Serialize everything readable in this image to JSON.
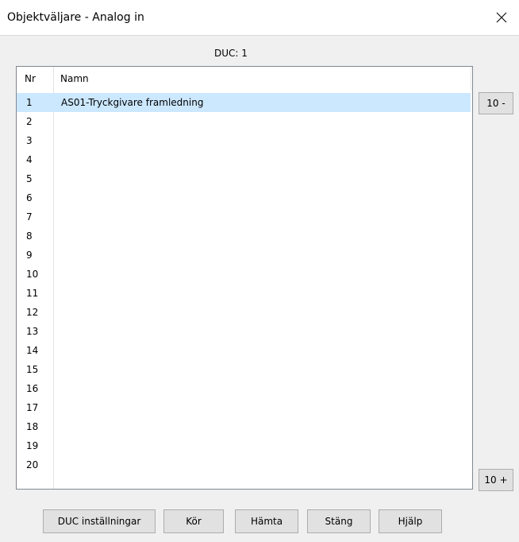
{
  "window": {
    "title": "Objektväljare - Analog in",
    "close_glyph": "✕"
  },
  "duc_label": "DUC:  1",
  "list": {
    "headers": {
      "nr": "Nr",
      "namn": "Namn"
    },
    "rows": [
      {
        "nr": "1",
        "namn": "AS01-Tryckgivare framledning"
      },
      {
        "nr": "2",
        "namn": ""
      },
      {
        "nr": "3",
        "namn": ""
      },
      {
        "nr": "4",
        "namn": ""
      },
      {
        "nr": "5",
        "namn": ""
      },
      {
        "nr": "6",
        "namn": ""
      },
      {
        "nr": "7",
        "namn": ""
      },
      {
        "nr": "8",
        "namn": ""
      },
      {
        "nr": "9",
        "namn": ""
      },
      {
        "nr": "10",
        "namn": ""
      },
      {
        "nr": "11",
        "namn": ""
      },
      {
        "nr": "12",
        "namn": ""
      },
      {
        "nr": "13",
        "namn": ""
      },
      {
        "nr": "14",
        "namn": ""
      },
      {
        "nr": "15",
        "namn": ""
      },
      {
        "nr": "16",
        "namn": ""
      },
      {
        "nr": "17",
        "namn": ""
      },
      {
        "nr": "18",
        "namn": ""
      },
      {
        "nr": "19",
        "namn": ""
      },
      {
        "nr": "20",
        "namn": ""
      }
    ],
    "selected_index": 0
  },
  "side_buttons": {
    "prev": "10 -",
    "next": "10 +"
  },
  "bottom_buttons": {
    "duc_settings": "DUC inställningar",
    "run": "Kör",
    "fetch": "Hämta",
    "close": "Stäng",
    "help": "Hjälp"
  },
  "colors": {
    "selection": "#cce8ff",
    "button_bg": "#e1e1e1",
    "dialog_bg": "#f0f0f0"
  }
}
